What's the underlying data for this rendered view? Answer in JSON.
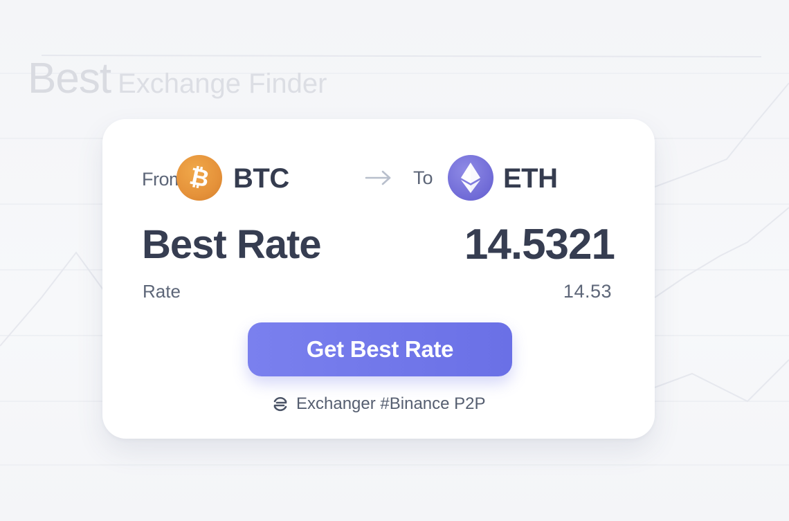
{
  "background": {
    "title_big": "Best",
    "title_small": "Exchange Finder"
  },
  "converter": {
    "from_label": "From",
    "from_symbol": "BTC",
    "from_icon": "bitcoin-icon",
    "arrow_icon": "arrow-right-icon",
    "to_label": "To",
    "to_symbol": "ETH",
    "to_icon": "ethereum-icon"
  },
  "result": {
    "best_rate_label": "Best Rate",
    "best_rate_value": "14.5321",
    "rate_label": "Rate",
    "rate_value": "14.53"
  },
  "action": {
    "button_label": "Get Best Rate"
  },
  "exchanger": {
    "icon": "exchanger-icon",
    "text": "Exchanger #Binance P2P"
  },
  "colors": {
    "accent": "#6c72e8",
    "btc": "#e5923a",
    "eth": "#6f6ad6",
    "text_dark": "#363d51",
    "text_muted": "#5d6678"
  }
}
